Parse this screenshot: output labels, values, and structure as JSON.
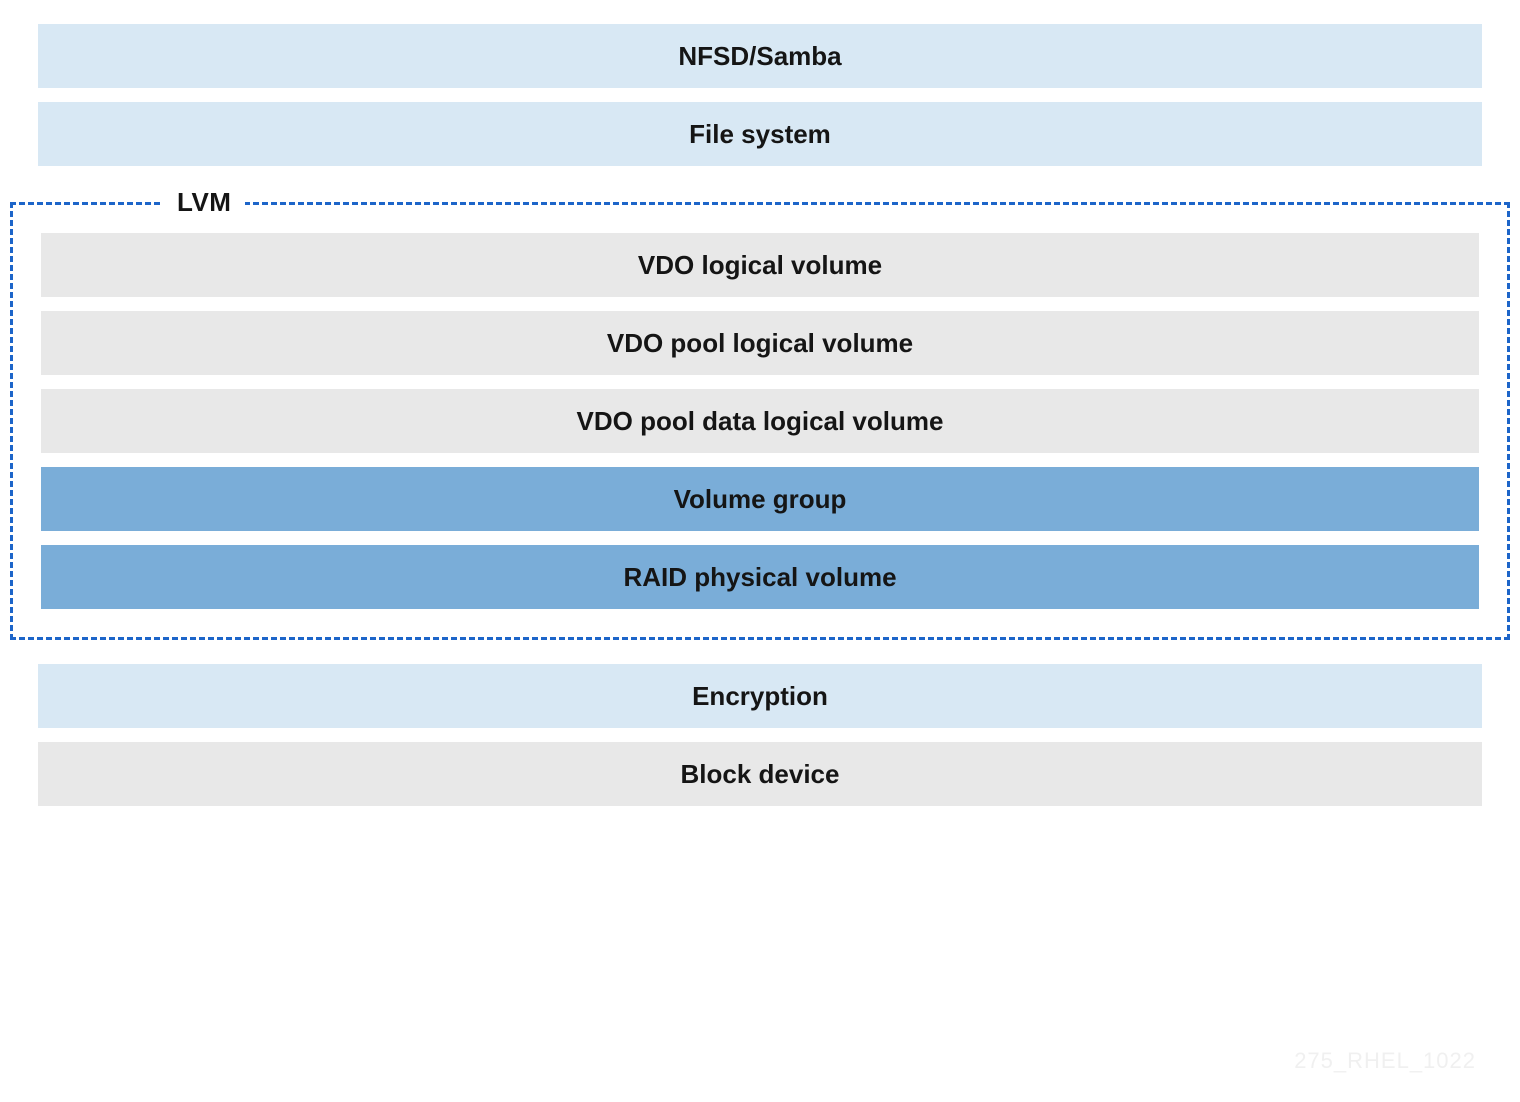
{
  "layers": {
    "top": [
      {
        "label": "NFSD/Samba",
        "style": "lightblue"
      },
      {
        "label": "File system",
        "style": "lightblue"
      }
    ],
    "lvm_label": "LVM",
    "lvm": [
      {
        "label": "VDO logical volume",
        "style": "gray"
      },
      {
        "label": "VDO pool logical volume",
        "style": "gray"
      },
      {
        "label": "VDO pool data logical volume",
        "style": "gray"
      },
      {
        "label": "Volume group",
        "style": "mediumblue"
      },
      {
        "label": "RAID physical volume",
        "style": "mediumblue"
      }
    ],
    "bottom": [
      {
        "label": "Encryption",
        "style": "lightblue"
      },
      {
        "label": "Block device",
        "style": "gray"
      }
    ]
  },
  "watermark": "275_RHEL_1022"
}
